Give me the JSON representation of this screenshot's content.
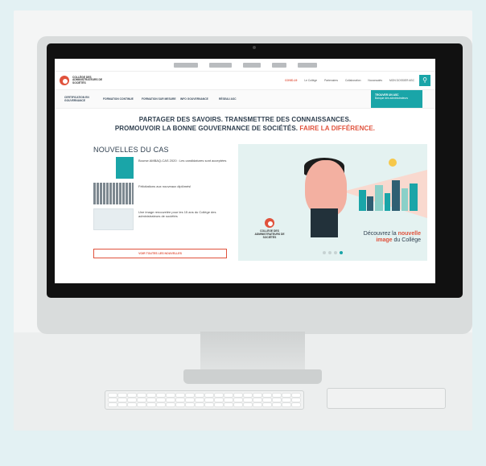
{
  "site": {
    "partners": [
      "partner-logo-1",
      "partner-logo-2",
      "partner-logo-3",
      "partner-logo-4",
      "partner-logo-5"
    ],
    "logo_text": "COLLÈGE DES ADMINISTRATEURS DE SOCIÉTÉS",
    "top_nav": [
      "COVID-19",
      "Le Collège",
      "Partenaires",
      "Collaboration",
      "Nouveautés",
      "MON DOSSIER ASC"
    ],
    "top_nav_highlight_color": "#e0523c",
    "search_icon": "search-icon",
    "main_nav": [
      "CERTIFICATION EN GOUVERNANCE",
      "FORMATION CONTINUE",
      "FORMATION SUR MESURE",
      "INFO GOUVERNANCE",
      "RÉSEAU ASC"
    ],
    "cta": {
      "title": "TROUVER UN ASC",
      "subtitle": "Banque des administrateurs"
    },
    "tagline_line1": "PARTAGER DES SAVOIRS. TRANSMETTRE DES CONNAISSANCES.",
    "tagline_line2": "PROMOUVOIR LA BONNE GOUVERNANCE DE SOCIÉTÉS.",
    "tagline_accent": "FAIRE LA DIFFÉRENCE.",
    "news_title": "NOUVELLES DU CAS",
    "news": [
      "Bourse AMBAQ-CAS 2020 : Les candidatures sont acceptées",
      "Félicitations aux nouveaux diplômés!",
      "Une image renouvelée pour les 15 ans du Collège des administrateurs de sociétés"
    ],
    "all_news": "VOIR TOUTES LES NOUVELLES",
    "hero_logo_text": "COLLÈGE DES ADMINISTRATEURS DE SOCIÉTÉS",
    "hero_text_1": "Découvrez la",
    "hero_text_accent_1": "nouvelle",
    "hero_text_accent_2": "image",
    "hero_text_2": "du Collège",
    "carousel_pages": 4,
    "carousel_active": 4,
    "accent_color": "#e0523c",
    "brand_color": "#1aa5a8"
  }
}
